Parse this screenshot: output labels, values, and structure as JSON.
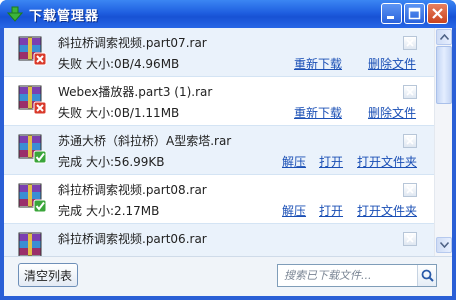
{
  "window": {
    "title": "下载管理器"
  },
  "items": [
    {
      "filename": "斜拉桥调索视频.part07.rar",
      "status": "失败",
      "size": "大小:0B/4.96MB",
      "actions": [
        "重新下载",
        "删除文件"
      ],
      "state": "failed"
    },
    {
      "filename": "Webex播放器.part3 (1).rar",
      "status": "失败",
      "size": "大小:0B/1.11MB",
      "actions": [
        "重新下载",
        "删除文件"
      ],
      "state": "failed"
    },
    {
      "filename": "苏通大桥（斜拉桥）A型索塔.rar",
      "status": "完成",
      "size": "大小:56.99KB",
      "actions": [
        "解压",
        "打开",
        "打开文件夹"
      ],
      "state": "done"
    },
    {
      "filename": "斜拉桥调索视频.part08.rar",
      "status": "完成",
      "size": "大小:2.17MB",
      "actions": [
        "解压",
        "打开",
        "打开文件夹"
      ],
      "state": "done"
    },
    {
      "filename": "斜拉桥调索视频.part06.rar",
      "status": "",
      "size": "",
      "actions": [],
      "state": "partial"
    }
  ],
  "footer": {
    "clear_label": "清空列表",
    "search_placeholder": "搜索已下载文件..."
  },
  "colors": {
    "titlebar": "#1f5fe0",
    "link": "#1a4fb5",
    "failed_badge": "#d93a2b",
    "done_badge": "#3aa53a"
  }
}
